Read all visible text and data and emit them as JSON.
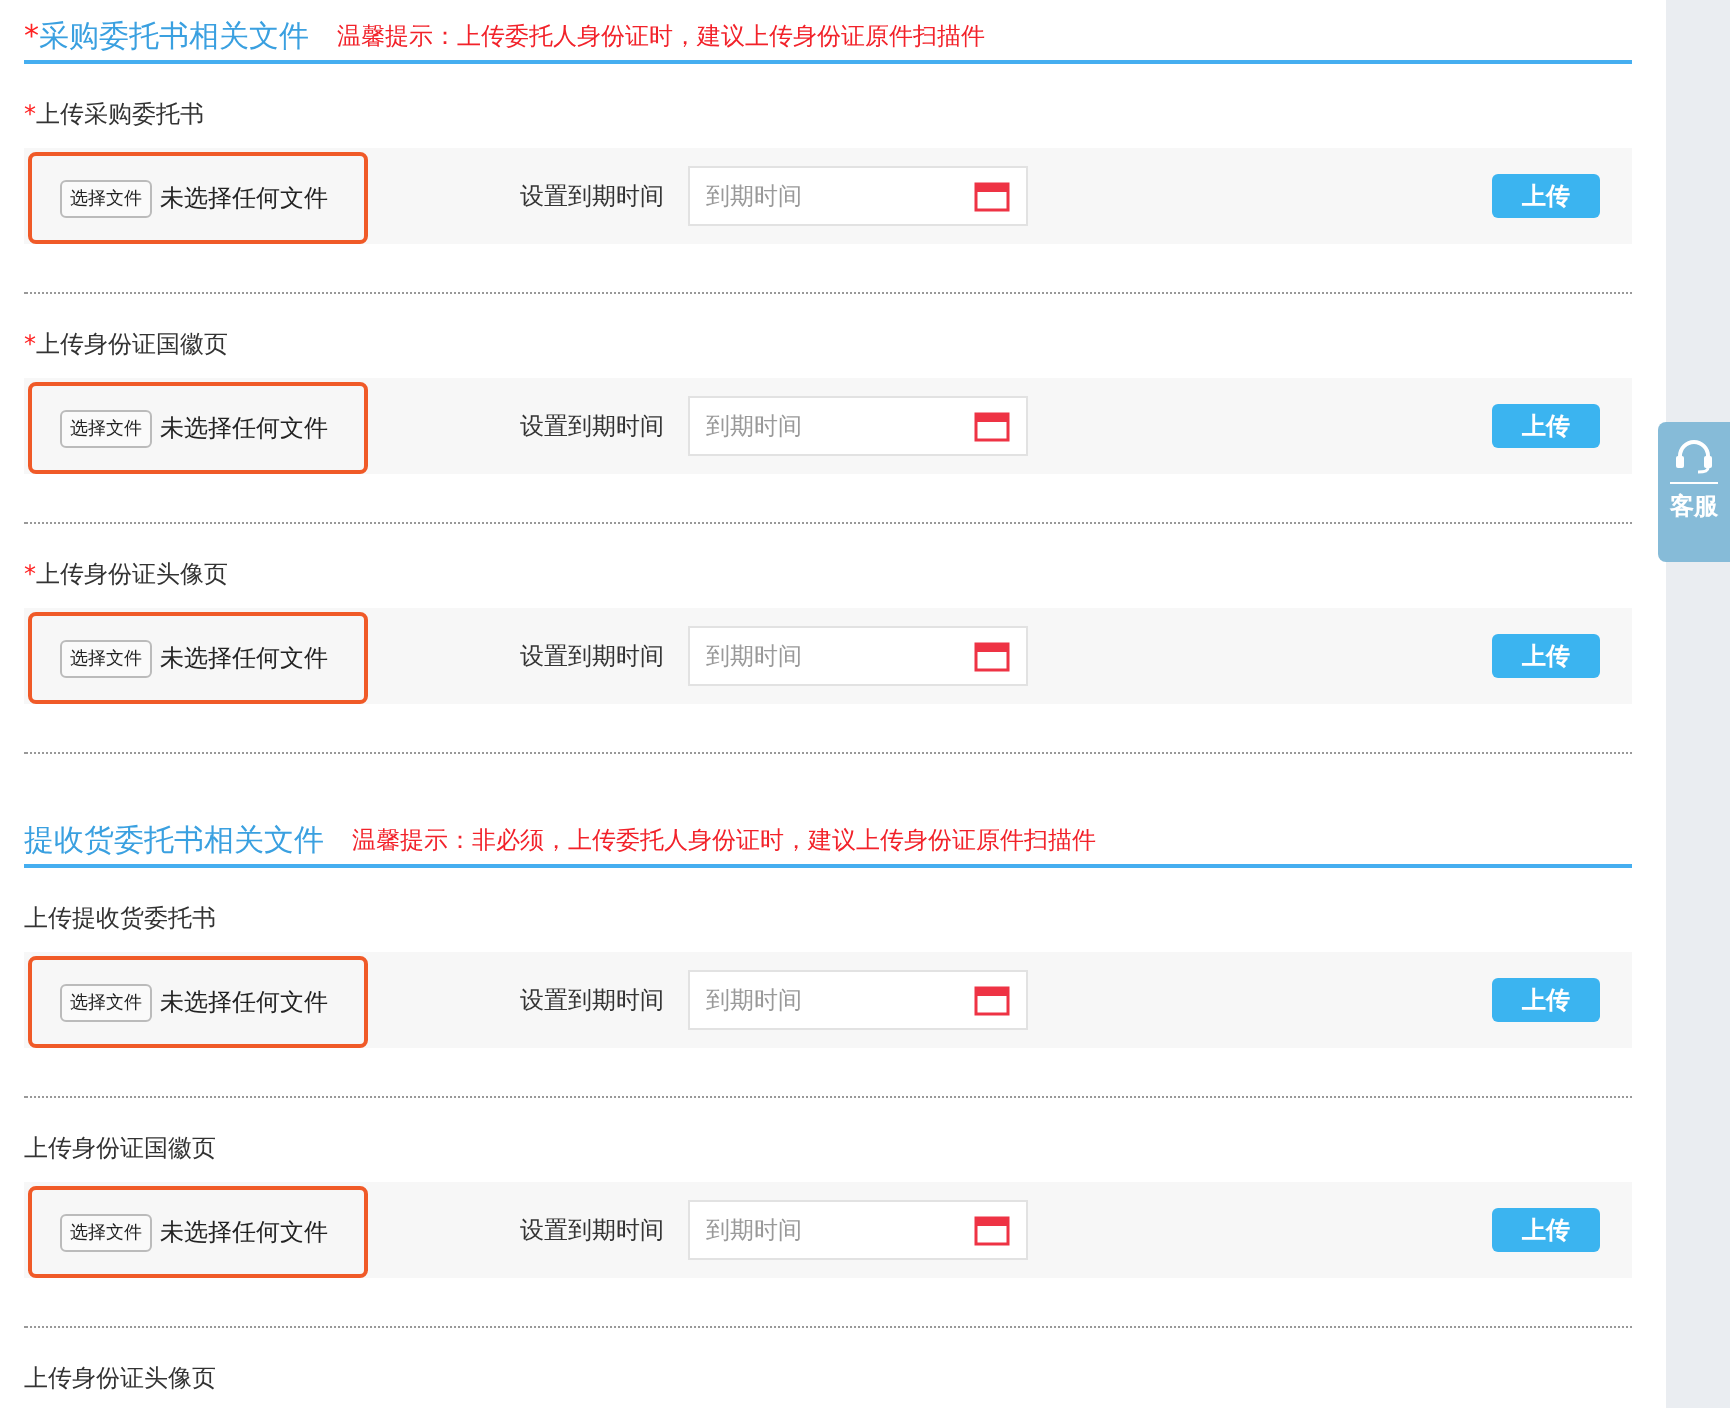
{
  "sections": [
    {
      "required_mark": "*",
      "title": "采购委托书相关文件",
      "hint": "温馨提示：上传委托人身份证时，建议上传身份证原件扫描件",
      "items": [
        {
          "kind": "upload",
          "required_mark": "*",
          "label": "上传采购委托书",
          "choose_button": "选择文件",
          "file_status": "未选择任何文件",
          "date_label": "设置到期时间",
          "date_placeholder": "到期时间",
          "upload_button": "上传"
        },
        {
          "kind": "upload",
          "required_mark": "*",
          "label": "上传身份证国徽页",
          "choose_button": "选择文件",
          "file_status": "未选择任何文件",
          "date_label": "设置到期时间",
          "date_placeholder": "到期时间",
          "upload_button": "上传"
        },
        {
          "kind": "upload",
          "required_mark": "*",
          "label": "上传身份证头像页",
          "choose_button": "选择文件",
          "file_status": "未选择任何文件",
          "date_label": "设置到期时间",
          "date_placeholder": "到期时间",
          "upload_button": "上传"
        }
      ]
    },
    {
      "title": "提收货委托书相关文件",
      "hint": "温馨提示：非必须，上传委托人身份证时，建议上传身份证原件扫描件",
      "items": [
        {
          "kind": "upload",
          "label": "上传提收货委托书",
          "choose_button": "选择文件",
          "file_status": "未选择任何文件",
          "date_label": "设置到期时间",
          "date_placeholder": "到期时间",
          "upload_button": "上传"
        },
        {
          "kind": "upload",
          "label": "上传身份证国徽页",
          "choose_button": "选择文件",
          "file_status": "未选择任何文件",
          "date_label": "设置到期时间",
          "date_placeholder": "到期时间",
          "upload_button": "上传"
        },
        {
          "kind": "label",
          "label": "上传身份证头像页"
        }
      ]
    }
  ],
  "service_tab": {
    "label": "客服"
  }
}
